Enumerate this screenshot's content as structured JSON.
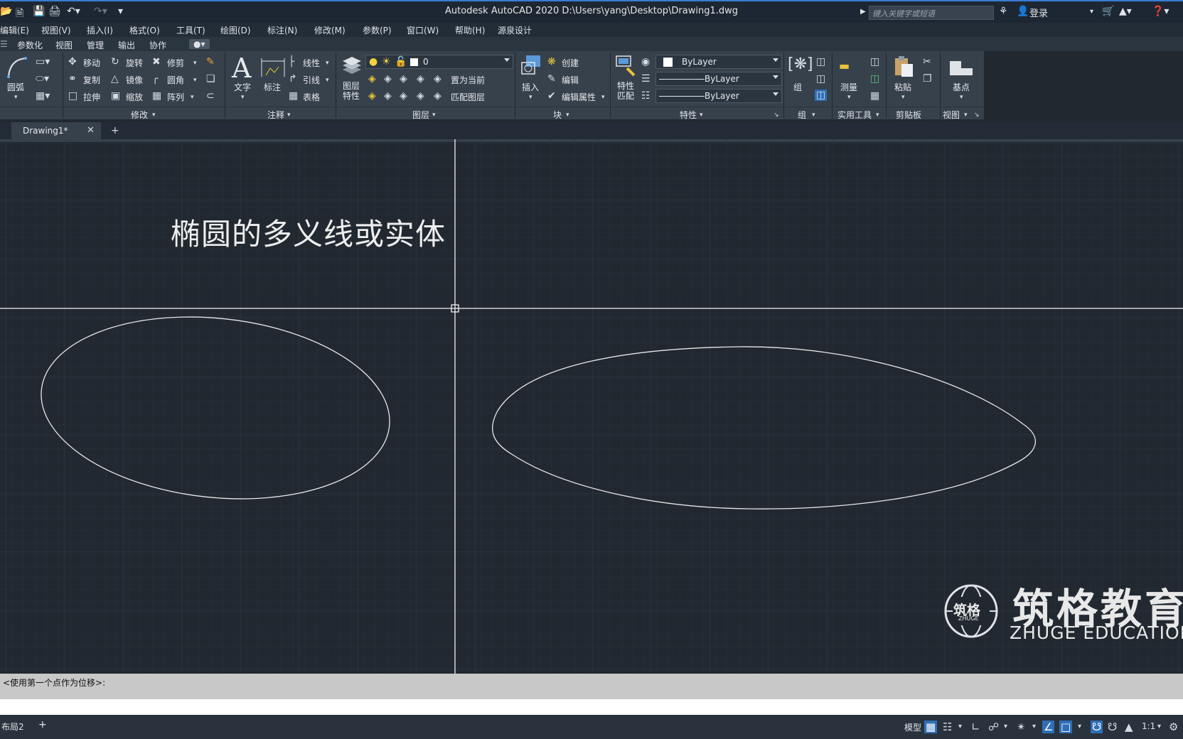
{
  "title_bar": {
    "app_title": "Autodesk AutoCAD 2020    D:\\Users\\yang\\Desktop\\Drawing1.dwg",
    "search_placeholder": "键入关键字或短语",
    "login": "登录"
  },
  "menu": [
    "编辑(E)",
    "视图(V)",
    "插入(I)",
    "格式(O)",
    "工具(T)",
    "绘图(D)",
    "标注(N)",
    "修改(M)",
    "参数(P)",
    "窗口(W)",
    "帮助(H)",
    "源泉设计"
  ],
  "ribbon_tabs": [
    "参数化",
    "视图",
    "管理",
    "输出",
    "协作"
  ],
  "ribbon": {
    "draw": {
      "arc": "圆弧"
    },
    "modify": {
      "label": "修改",
      "move": "移动",
      "rotate": "旋转",
      "trim": "修剪",
      "copy": "复制",
      "mirror": "镜像",
      "fillet": "圆角",
      "stretch": "拉伸",
      "scale": "缩放",
      "array": "阵列"
    },
    "annotation": {
      "label": "注释",
      "text": "文字",
      "dimension": "标注",
      "linear": "线性",
      "leader": "引线",
      "table": "表格"
    },
    "layers": {
      "label": "图层",
      "layer_props": "图层\n特性",
      "current_layer": "0",
      "set_current": "置为当前",
      "match_layer": "匹配图层"
    },
    "block": {
      "label": "块",
      "insert": "插入",
      "create": "创建",
      "edit": "编辑",
      "edit_attr": "编辑属性"
    },
    "properties": {
      "label": "特性",
      "match": "特性\n匹配",
      "color": "ByLayer",
      "linetype": "ByLayer",
      "lineweight": "ByLayer"
    },
    "groups": {
      "label": "组",
      "group": "组"
    },
    "utilities": {
      "label": "实用工具",
      "measure": "测量"
    },
    "clipboard": {
      "label": "剪贴板",
      "paste": "粘贴"
    },
    "view": {
      "label": "视图",
      "base": "基点"
    }
  },
  "doc_tab": {
    "name": "Drawing1*"
  },
  "canvas": {
    "annotation_text": "椭圆的多义线或实体",
    "watermark_cn": "筑格教育",
    "watermark_en": "ZHUGE EDUCATION",
    "watermark_logo_text": "筑格",
    "watermark_logo_sub": "ZHUGE"
  },
  "command_line": {
    "prompt": "<使用第一个点作为位移>:"
  },
  "status_bar": {
    "layout_tab": "布局2",
    "model": "模型",
    "scale": "1:1"
  },
  "colors": {
    "background": "#212830",
    "ribbon": "#37414c",
    "accent": "#2f6fb7",
    "drawing_line": "#e8e8e8"
  }
}
